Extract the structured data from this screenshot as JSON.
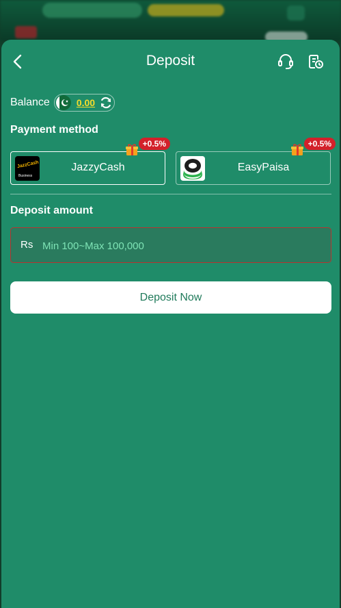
{
  "header": {
    "title": "Deposit",
    "back_icon": "chevron-left-icon",
    "support_icon": "headset-icon",
    "history_icon": "history-icon"
  },
  "balance": {
    "label": "Balance",
    "value": "0.00",
    "currency_flag": "pakistan-flag-icon",
    "refresh_icon": "refresh-icon"
  },
  "payment": {
    "title": "Payment method",
    "methods": [
      {
        "name": "JazzyCash",
        "bonus": "+0.5%",
        "selected": true,
        "logo_text": "JazzCash",
        "logo_sub": "Business"
      },
      {
        "name": "EasyPaisa",
        "bonus": "+0.5%",
        "selected": false
      }
    ]
  },
  "amount": {
    "title": "Deposit amount",
    "currency": "Rs",
    "placeholder": "Min 100~Max 100,000"
  },
  "actions": {
    "deposit_label": "Deposit Now"
  },
  "colors": {
    "sheet_bg": "#1f8c69",
    "accent_yellow": "#f4dc2c",
    "badge_red": "#d3202a",
    "input_border": "#b8332f",
    "placeholder": "#7ee3b5"
  }
}
